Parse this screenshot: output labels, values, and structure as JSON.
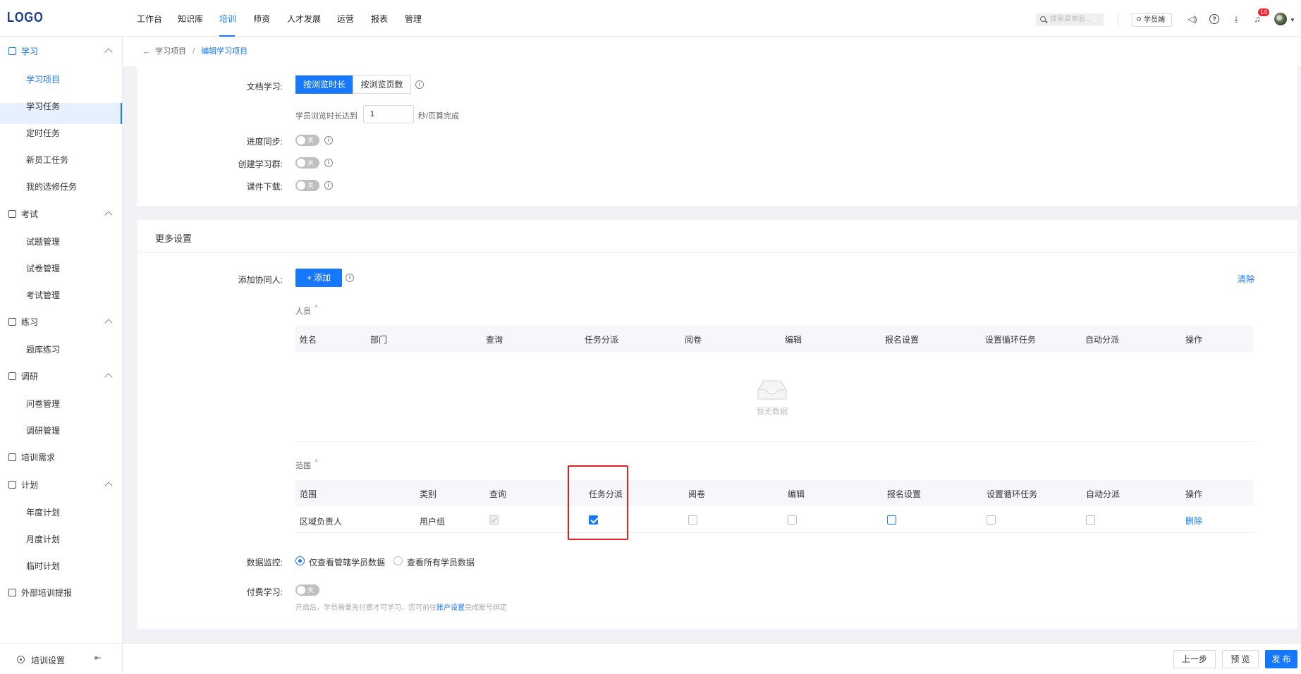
{
  "header": {
    "logo": "LOGO",
    "nav": [
      "工作台",
      "知识库",
      "培训",
      "师资",
      "人才发展",
      "运营",
      "报表",
      "管理"
    ],
    "active_nav": "培训",
    "search_placeholder": "搜索菜单名...",
    "student_button": "学员端",
    "notification_count": "14"
  },
  "sidebar": {
    "groups": [
      {
        "label": "学习",
        "items": [
          "学习项目",
          "学习任务",
          "定时任务",
          "新员工任务",
          "我的选修任务"
        ]
      },
      {
        "label": "考试",
        "items": [
          "试题管理",
          "试卷管理",
          "考试管理"
        ]
      },
      {
        "label": "练习",
        "items": [
          "题库练习"
        ]
      },
      {
        "label": "调研",
        "items": [
          "问卷管理",
          "调研管理"
        ]
      },
      {
        "label": "培训需求",
        "items": []
      },
      {
        "label": "计划",
        "items": [
          "年度计划",
          "月度计划",
          "临时计划"
        ]
      },
      {
        "label": "外部培训提报",
        "items": []
      }
    ],
    "active_item": "学习项目",
    "footer_label": "培训设置"
  },
  "breadcrumb": {
    "parent": "学习项目",
    "separator": "/",
    "current": "编辑学习项目"
  },
  "doc_learning": {
    "label": "文档学习:",
    "options": [
      "按浏览时长",
      "按浏览页数"
    ],
    "selected": "按浏览时长",
    "hint_prefix": "学员浏览时长达到",
    "seconds_value": "1",
    "hint_suffix": "秒/页算完成"
  },
  "toggles": [
    {
      "label": "进度同步:",
      "state": "关"
    },
    {
      "label": "创建学习群:",
      "state": "关"
    },
    {
      "label": "课件下载:",
      "state": "关"
    }
  ],
  "more_settings": {
    "title": "更多设置",
    "collaborator_label": "添加协同人:",
    "add_button": "+ 添加",
    "clear_link": "清除",
    "people": {
      "title": "人员",
      "columns": [
        "姓名",
        "部门",
        "查询",
        "任务分派",
        "阅卷",
        "编辑",
        "报名设置",
        "设置循环任务",
        "自动分派",
        "操作"
      ],
      "empty_text": "暂无数据"
    },
    "scope": {
      "title": "范围",
      "columns": [
        "范围",
        "类别",
        "查询",
        "任务分派",
        "阅卷",
        "编辑",
        "报名设置",
        "设置循环任务",
        "自动分派",
        "操作"
      ],
      "rows": [
        {
          "scope": "区域负责人",
          "category": "用户组",
          "query": "checked-disabled",
          "assign": "checked",
          "grade": "unchecked",
          "edit": "unchecked",
          "signup": "unchecked",
          "loop": "unchecked",
          "auto": "unchecked",
          "action": "删除"
        }
      ]
    },
    "data_monitor": {
      "label": "数据监控:",
      "options": [
        "仅查看管辖学员数据",
        "查看所有学员数据"
      ],
      "selected": "仅查看管辖学员数据"
    },
    "paid_learning": {
      "label": "付费学习:",
      "state": "关",
      "note_prefix": "开启后，学员需要先付费才可学习，您可前往",
      "note_link": "账户设置",
      "note_suffix": "完成账号绑定"
    }
  },
  "footer_buttons": {
    "prev": "上一步",
    "preview": "预 览",
    "publish": "发 布"
  },
  "colors": {
    "accent": "#1677ff",
    "highlight_box": "#e02020"
  }
}
